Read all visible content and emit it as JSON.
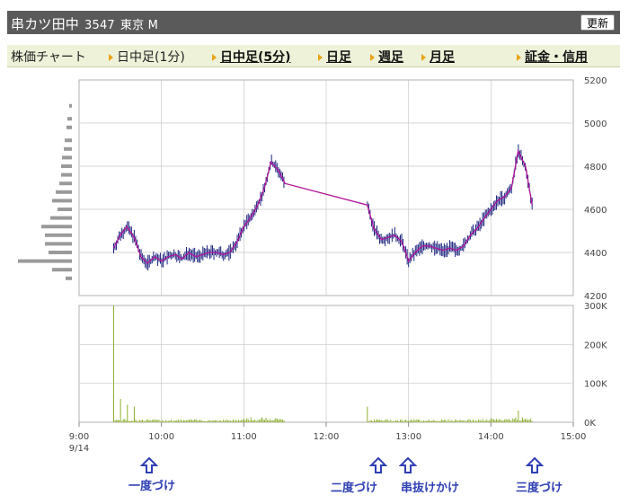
{
  "header": {
    "company": "串カツ田中",
    "code": "3547",
    "market": "東京 M",
    "refresh_label": "更新"
  },
  "tabs": {
    "current": "株価チャート",
    "items": [
      {
        "label": "日中足(1分)",
        "link": false
      },
      {
        "label": "日中足(5分)",
        "link": true
      },
      {
        "label": "日足",
        "link": true
      },
      {
        "label": "週足",
        "link": true
      },
      {
        "label": "月足",
        "link": true
      },
      {
        "label": "証金・信用",
        "link": true
      }
    ]
  },
  "chart_data": {
    "type": "candlestick-intraday",
    "price_axis": {
      "ticks": [
        "5200",
        "5000",
        "4800",
        "4600",
        "4400",
        "4200"
      ],
      "ylim": [
        4200,
        5200
      ]
    },
    "volume_axis": {
      "ticks": [
        "300K",
        "200K",
        "100K",
        "0K"
      ],
      "ylim": [
        0,
        300000
      ]
    },
    "x_ticks": [
      "9:00",
      "10:00",
      "11:00",
      "12:00",
      "13:00",
      "14:00",
      "15:00"
    ],
    "date_label": "9/14",
    "colors": {
      "bar": "#1a237e",
      "ma": "#b0139a",
      "volume": "#8fb030",
      "grid": "#c8c8c8",
      "profile": "#9a9a9a"
    },
    "morning_points": [
      [
        9.42,
        4420
      ],
      [
        9.5,
        4480
      ],
      [
        9.58,
        4520
      ],
      [
        9.67,
        4470
      ],
      [
        9.75,
        4380
      ],
      [
        9.83,
        4350
      ],
      [
        9.92,
        4380
      ],
      [
        10.0,
        4360
      ],
      [
        10.08,
        4380
      ],
      [
        10.17,
        4390
      ],
      [
        10.25,
        4370
      ],
      [
        10.33,
        4400
      ],
      [
        10.42,
        4380
      ],
      [
        10.5,
        4390
      ],
      [
        10.58,
        4400
      ],
      [
        10.67,
        4400
      ],
      [
        10.75,
        4390
      ],
      [
        10.83,
        4400
      ],
      [
        10.92,
        4450
      ],
      [
        11.0,
        4520
      ],
      [
        11.08,
        4560
      ],
      [
        11.17,
        4620
      ],
      [
        11.25,
        4700
      ],
      [
        11.33,
        4820
      ],
      [
        11.42,
        4780
      ],
      [
        11.5,
        4720
      ]
    ],
    "afternoon_points": [
      [
        12.5,
        4620
      ],
      [
        12.58,
        4510
      ],
      [
        12.67,
        4460
      ],
      [
        12.75,
        4470
      ],
      [
        12.83,
        4480
      ],
      [
        12.92,
        4450
      ],
      [
        13.0,
        4360
      ],
      [
        13.08,
        4400
      ],
      [
        13.17,
        4430
      ],
      [
        13.25,
        4430
      ],
      [
        13.33,
        4420
      ],
      [
        13.42,
        4410
      ],
      [
        13.5,
        4420
      ],
      [
        13.58,
        4410
      ],
      [
        13.67,
        4430
      ],
      [
        13.75,
        4480
      ],
      [
        13.83,
        4510
      ],
      [
        13.92,
        4560
      ],
      [
        14.0,
        4600
      ],
      [
        14.08,
        4640
      ],
      [
        14.17,
        4660
      ],
      [
        14.25,
        4700
      ],
      [
        14.33,
        4870
      ],
      [
        14.42,
        4800
      ],
      [
        14.5,
        4620
      ]
    ],
    "volume_spikes": [
      [
        9.42,
        300000
      ],
      [
        9.5,
        60000
      ],
      [
        9.58,
        45000
      ],
      [
        9.67,
        40000
      ],
      [
        12.5,
        40000
      ],
      [
        14.33,
        30000
      ]
    ],
    "volume_profile": [
      [
        5080,
        3
      ],
      [
        5020,
        5
      ],
      [
        4980,
        6
      ],
      [
        4920,
        8
      ],
      [
        4880,
        9
      ],
      [
        4840,
        11
      ],
      [
        4800,
        12
      ],
      [
        4760,
        12
      ],
      [
        4720,
        14
      ],
      [
        4680,
        18
      ],
      [
        4640,
        22
      ],
      [
        4600,
        16
      ],
      [
        4560,
        24
      ],
      [
        4520,
        34
      ],
      [
        4480,
        30
      ],
      [
        4440,
        30
      ],
      [
        4400,
        26
      ],
      [
        4360,
        60
      ],
      [
        4320,
        22
      ],
      [
        4280,
        7
      ]
    ]
  },
  "annotations": [
    {
      "label": "一度づけ"
    },
    {
      "label": "二度づけ"
    },
    {
      "label": "串抜けかけ"
    },
    {
      "label": "三度づけ"
    }
  ]
}
